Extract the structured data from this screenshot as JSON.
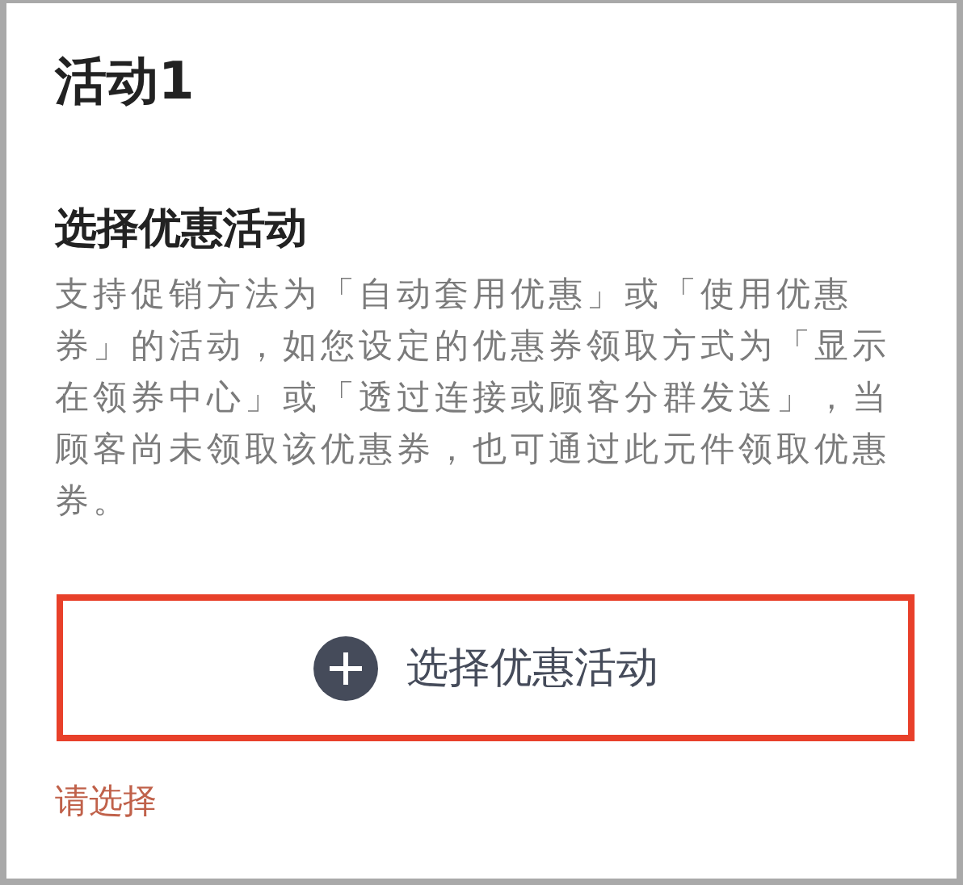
{
  "title": "活动1",
  "section": {
    "heading": "选择优惠活动",
    "description": "支持促销方法为「自动套用优惠」或「使用优惠券」的活动，如您设定的优惠券领取方式为「显示在领券中心」或「透过连接或顾客分群发送」，当顾客尚未领取该优惠券，也可通过此元件领取优惠券。"
  },
  "select_button": {
    "label": "选择优惠活动",
    "invalid": true
  },
  "error": "请选择"
}
